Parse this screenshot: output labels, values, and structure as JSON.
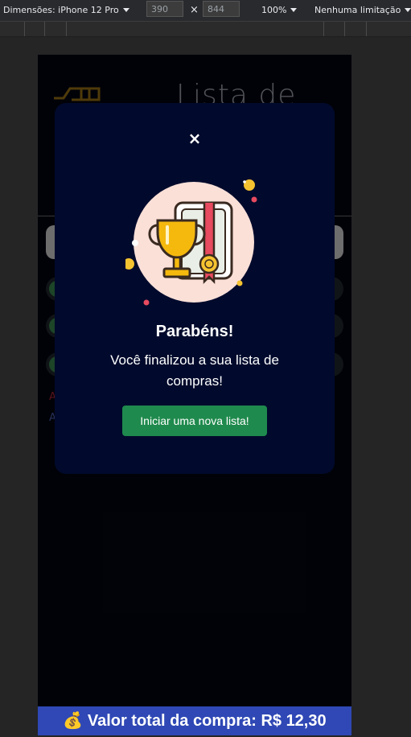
{
  "devtools": {
    "device_label": "Dimensões: iPhone 12 Pro",
    "width": "390",
    "times": "×",
    "height": "844",
    "zoom": "100%",
    "throttle": "Nenhuma limitação"
  },
  "page": {
    "title_partial": "Lista de",
    "links": [
      "A",
      "A"
    ],
    "total_label": "💰 Valor total da compra: R$ 12,30"
  },
  "modal": {
    "close_symbol": "×",
    "title": "Parabéns!",
    "message": "Você finalizou a sua lista de compras!",
    "button_label": "Iniciar uma nova lista!"
  },
  "colors": {
    "modal_bg": "#010a2c",
    "button_bg": "#1f8a4d",
    "total_bar_bg": "#2f48b5"
  }
}
